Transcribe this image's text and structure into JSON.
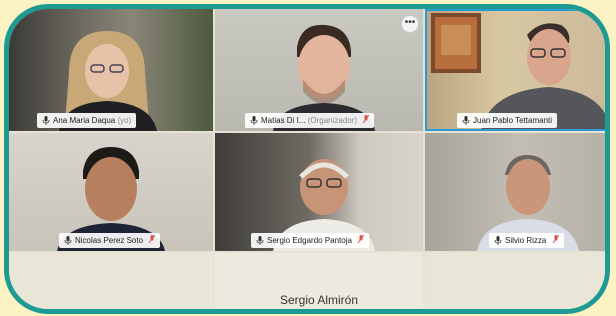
{
  "participants": [
    {
      "name": "Ana Maria Daqua",
      "suffix": "(yo)",
      "muted": false
    },
    {
      "name": "Matias Di I...",
      "suffix": "(Organizador)",
      "muted": true
    },
    {
      "name": "Juan Pablo Tettamanti",
      "suffix": "",
      "muted": false
    },
    {
      "name": "Nicolas Perez Soto",
      "suffix": "",
      "muted": true
    },
    {
      "name": "Sergio Edgardo Pantoja",
      "suffix": "",
      "muted": true
    },
    {
      "name": "Silvio Rizza",
      "suffix": "",
      "muted": true
    }
  ],
  "bottom_participant": {
    "name": "Sergio Almirón"
  },
  "more_label": "•••",
  "colors": {
    "frame": "#1d9b92",
    "background": "#fbf3c4",
    "active_speaker": "#2a9bd4",
    "muted": "#d9534f"
  }
}
